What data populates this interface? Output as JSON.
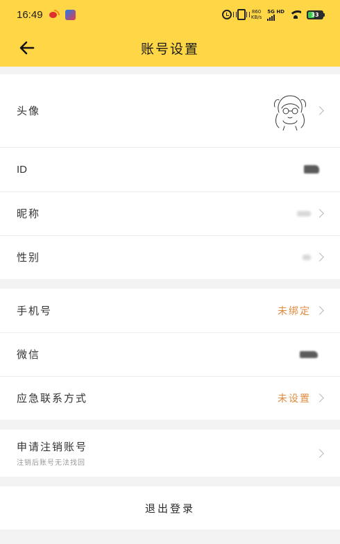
{
  "status_bar": {
    "time": "16:49",
    "net_speed_value": "860",
    "net_speed_unit": "KB/s",
    "network_label": "5G HD",
    "battery_level": "33"
  },
  "header": {
    "title": "账号设置"
  },
  "rows": {
    "avatar": {
      "label": "头像"
    },
    "id": {
      "label": "ID"
    },
    "nickname": {
      "label": "昵称"
    },
    "gender": {
      "label": "性别"
    },
    "phone": {
      "label": "手机号",
      "value": "未绑定"
    },
    "wechat": {
      "label": "微信"
    },
    "emergency": {
      "label": "应急联系方式",
      "value": "未设置"
    },
    "deactivate": {
      "label": "申请注销账号",
      "sublabel": "注销后账号无法找回"
    }
  },
  "logout": {
    "label": "退出登录"
  },
  "colors": {
    "header_bg": "#ffd645",
    "accent_value": "#e08a3c",
    "page_bg": "#f3f3f3"
  }
}
